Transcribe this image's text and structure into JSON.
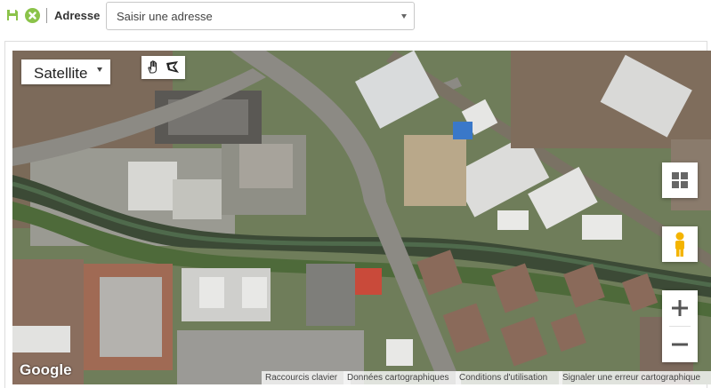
{
  "toolbar": {
    "address_label": "Adresse",
    "address_placeholder": "Saisir une adresse",
    "save_icon": "save-icon",
    "cancel_icon": "cancel-icon",
    "accent_color": "#8bc34a"
  },
  "map": {
    "map_type": "Satellite",
    "brand": "Google",
    "footer": {
      "shortcuts": "Raccourcis clavier",
      "map_data": "Données cartographiques",
      "terms": "Conditions d'utilisation",
      "report": "Signaler une erreur cartographique"
    },
    "controls": {
      "zoom_in": "+",
      "zoom_out": "−"
    }
  }
}
